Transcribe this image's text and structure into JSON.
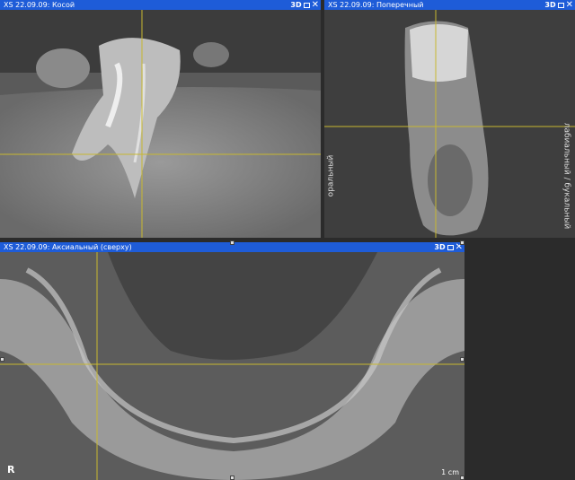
{
  "colors": {
    "titlebar": "#1e5cd8",
    "crosshair": "#c8b830"
  },
  "panels": {
    "oblique": {
      "title": "XS 22.09.09: Косой",
      "btn_3d": "3D",
      "icons": [
        "maximize-icon",
        "close-icon"
      ]
    },
    "transverse": {
      "title": "XS 22.09.09: Поперечный",
      "btn_3d": "3D",
      "label_left": "оральный",
      "label_right": "лабиальный / букальный",
      "icons": [
        "maximize-icon",
        "close-icon"
      ]
    },
    "axial": {
      "title": "XS 22.09.09: Аксиальный (сверху)",
      "btn_3d": "3D",
      "orientation": "R",
      "scale": "1 cm",
      "icons": [
        "maximize-icon",
        "close-icon"
      ]
    }
  }
}
